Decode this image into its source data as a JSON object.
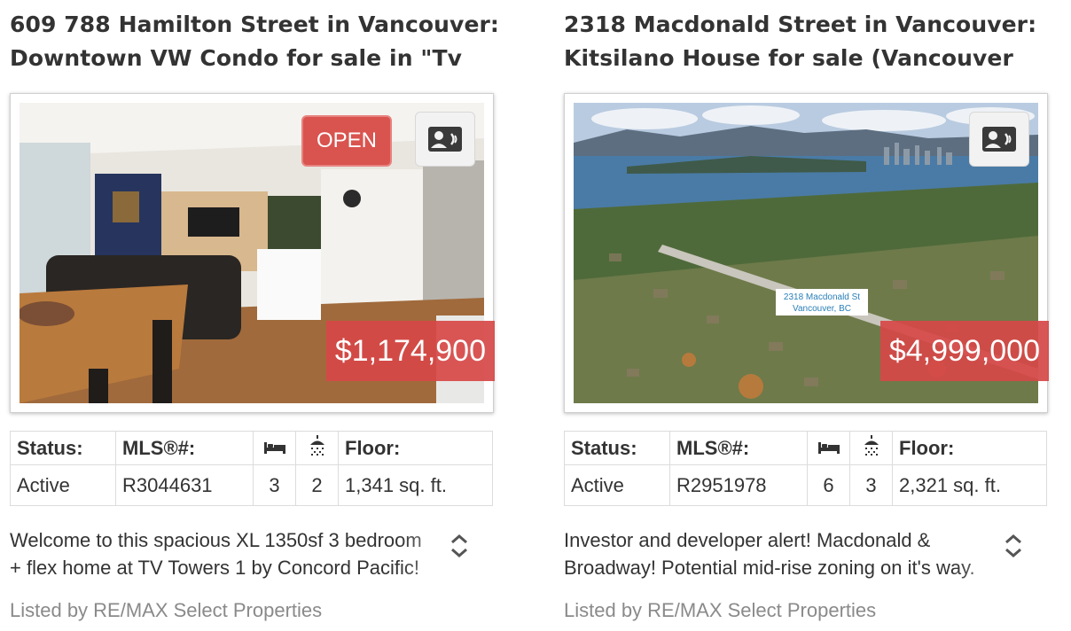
{
  "listings": [
    {
      "title_line1": "609 788 Hamilton Street in Vancouver:",
      "title_line2": "Downtown VW Condo for sale in \"Tv",
      "open_badge": "OPEN",
      "price": "$1,174,900",
      "headers": {
        "status": "Status:",
        "mls": "MLS®#:",
        "floor": "Floor:"
      },
      "status": "Active",
      "mls": "R3044631",
      "beds": "3",
      "baths": "2",
      "floor": "1,341 sq. ft.",
      "desc_line1": "Welcome to this spacious XL 1350sf 3 bedroom",
      "desc_line2": "+ flex home at TV Towers 1 by Concord Pacific!",
      "listed_by": "Listed by RE/MAX Select Properties"
    },
    {
      "title_line1": "2318 Macdonald Street in Vancouver:",
      "title_line2": "Kitsilano House for sale (Vancouver",
      "photo_label_line1": "2318 Macdonald St",
      "photo_label_line2": "Vancouver, BC",
      "price": "$4,999,000",
      "headers": {
        "status": "Status:",
        "mls": "MLS®#:",
        "floor": "Floor:"
      },
      "status": "Active",
      "mls": "R2951978",
      "beds": "6",
      "baths": "3",
      "floor": "2,321 sq. ft.",
      "desc_line1": "Investor and developer alert! Macdonald &",
      "desc_line2": "Broadway! Potential mid-rise zoning on it's way.",
      "listed_by": "Listed by RE/MAX Select Properties"
    }
  ],
  "colors": {
    "price_bg": "#d64848",
    "open_bg": "#d9534f",
    "text": "#333333",
    "muted": "#8a8a8a",
    "border": "#dcdcdc"
  },
  "icons": [
    "contact-card-icon",
    "bed-icon",
    "shower-icon",
    "chevron-up-icon",
    "chevron-down-icon"
  ]
}
